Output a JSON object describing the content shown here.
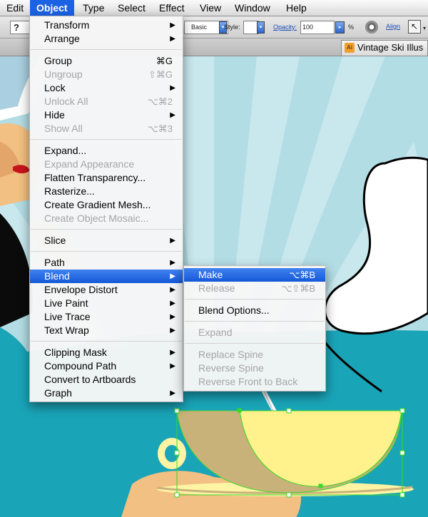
{
  "menubar": {
    "items": [
      "Edit",
      "Object",
      "Type",
      "Select",
      "Effect",
      "View",
      "Window",
      "Help"
    ],
    "active": "Object"
  },
  "controlbar": {
    "question_glyph": "?",
    "stroke_value": "Basic",
    "style_label": "Style:",
    "opacity_label": "Opacity:",
    "opacity_value": "100",
    "percent": "%",
    "align_label": "Align"
  },
  "document": {
    "tab_title": "Vintage Ski Illus",
    "tab_icon": "Ai"
  },
  "object_menu": {
    "groups": [
      [
        {
          "label": "Transform",
          "submenu": true
        },
        {
          "label": "Arrange",
          "submenu": true
        }
      ],
      [
        {
          "label": "Group",
          "shortcut": "⌘G"
        },
        {
          "label": "Ungroup",
          "shortcut": "⇧⌘G",
          "disabled": true
        },
        {
          "label": "Lock",
          "submenu": true
        },
        {
          "label": "Unlock All",
          "shortcut": "⌥⌘2",
          "disabled": true
        },
        {
          "label": "Hide",
          "submenu": true
        },
        {
          "label": "Show All",
          "shortcut": "⌥⌘3",
          "disabled": true
        }
      ],
      [
        {
          "label": "Expand..."
        },
        {
          "label": "Expand Appearance",
          "disabled": true
        },
        {
          "label": "Flatten Transparency..."
        },
        {
          "label": "Rasterize..."
        },
        {
          "label": "Create Gradient Mesh..."
        },
        {
          "label": "Create Object Mosaic...",
          "disabled": true
        }
      ],
      [
        {
          "label": "Slice",
          "submenu": true
        }
      ],
      [
        {
          "label": "Path",
          "submenu": true
        },
        {
          "label": "Blend",
          "submenu": true,
          "highlighted": true
        },
        {
          "label": "Envelope Distort",
          "submenu": true
        },
        {
          "label": "Live Paint",
          "submenu": true
        },
        {
          "label": "Live Trace",
          "submenu": true
        },
        {
          "label": "Text Wrap",
          "submenu": true
        }
      ],
      [
        {
          "label": "Clipping Mask",
          "submenu": true
        },
        {
          "label": "Compound Path",
          "submenu": true
        },
        {
          "label": "Convert to Artboards"
        },
        {
          "label": "Graph",
          "submenu": true
        }
      ]
    ]
  },
  "blend_submenu": {
    "groups": [
      [
        {
          "label": "Make",
          "shortcut": "⌥⌘B",
          "highlighted": true
        },
        {
          "label": "Release",
          "shortcut": "⌥⇧⌘B",
          "disabled": true
        }
      ],
      [
        {
          "label": "Blend Options..."
        }
      ],
      [
        {
          "label": "Expand",
          "disabled": true
        }
      ],
      [
        {
          "label": "Replace Spine",
          "disabled": true
        },
        {
          "label": "Reverse Spine",
          "disabled": true
        },
        {
          "label": "Reverse Front to Back",
          "disabled": true
        }
      ]
    ]
  },
  "colors": {
    "menu_highlight": "#1c62e4",
    "sky_teal": "#5fb8c4",
    "table_teal": "#1aa4b8",
    "selection_green": "#39d82a",
    "cup_yellow": "#fff18c",
    "cup_khaki": "#c9b27a"
  }
}
